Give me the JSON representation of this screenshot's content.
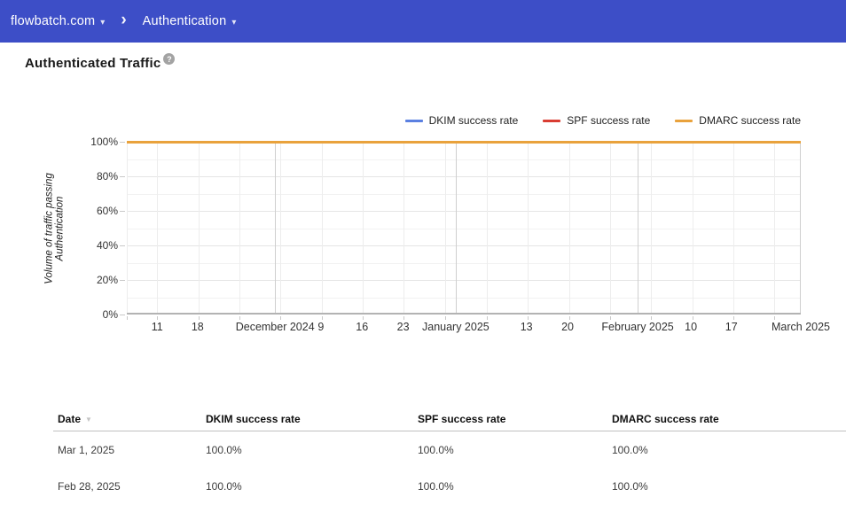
{
  "nav": {
    "domain": "flowbatch.com",
    "section": "Authentication"
  },
  "icons": {
    "dropdown_caret": "▾",
    "breadcrumb_chevron": "›",
    "help": "?",
    "sort_desc": "▼"
  },
  "page": {
    "title": "Authenticated Traffic"
  },
  "chart_data": {
    "type": "line",
    "title": "Authenticated Traffic",
    "xlabel": "",
    "ylabel": "Volume of traffic passing Authentication",
    "ylim": [
      0,
      100
    ],
    "grid": true,
    "legend_position": "top-right",
    "series": [
      {
        "name": "DKIM success rate",
        "color": "#5b80e1",
        "constant_value_pct": 100
      },
      {
        "name": "SPF success rate",
        "color": "#d93d32",
        "constant_value_pct": 100
      },
      {
        "name": "DMARC success rate",
        "color": "#e9a23c",
        "constant_value_pct": 100
      }
    ],
    "y_ticks": [
      {
        "label": "0%",
        "pct": 0
      },
      {
        "label": "20%",
        "pct": 20
      },
      {
        "label": "40%",
        "pct": 40
      },
      {
        "label": "60%",
        "pct": 60
      },
      {
        "label": "80%",
        "pct": 80
      },
      {
        "label": "100%",
        "pct": 100
      }
    ],
    "x_ticks": [
      {
        "label": "11",
        "frac": 0.045
      },
      {
        "label": "18",
        "frac": 0.105
      },
      {
        "label": "December 2024",
        "frac": 0.22
      },
      {
        "label": "9",
        "frac": 0.288
      },
      {
        "label": "16",
        "frac": 0.349
      },
      {
        "label": "23",
        "frac": 0.41
      },
      {
        "label": "January 2025",
        "frac": 0.488
      },
      {
        "label": "13",
        "frac": 0.593
      },
      {
        "label": "20",
        "frac": 0.654
      },
      {
        "label": "February 2025",
        "frac": 0.758
      },
      {
        "label": "10",
        "frac": 0.837
      },
      {
        "label": "17",
        "frac": 0.897
      },
      {
        "label": "March 2025",
        "frac": 1.0
      }
    ],
    "layout": {
      "y_minor_step_pct": 10,
      "y_major_step_pct": 20,
      "weekly_gridline_fracs": [
        0,
        0.045,
        0.106,
        0.167,
        0.228,
        0.289,
        0.35,
        0.411,
        0.472,
        0.534,
        0.595,
        0.656,
        0.717,
        0.778,
        0.839,
        0.9,
        0.961
      ],
      "month_gridline_fracs": [
        0.22,
        0.488,
        0.758,
        1.0
      ],
      "minor_grid_color": "#f2f2f2",
      "major_grid_color": "#e5e5e5",
      "weekly_grid_color": "#ededed",
      "month_grid_color": "#cfcfcf"
    }
  },
  "table": {
    "columns": [
      "Date",
      "DKIM success rate",
      "SPF success rate",
      "DMARC success rate"
    ],
    "rows": [
      [
        "Mar 1, 2025",
        "100.0%",
        "100.0%",
        "100.0%"
      ],
      [
        "Feb 28, 2025",
        "100.0%",
        "100.0%",
        "100.0%"
      ]
    ]
  },
  "colors": {
    "navbar_bg": "#3d4ec7",
    "dkim_blue": "#5b80e1",
    "spf_red": "#d93d32",
    "dmarc_orange": "#e9a23c"
  }
}
